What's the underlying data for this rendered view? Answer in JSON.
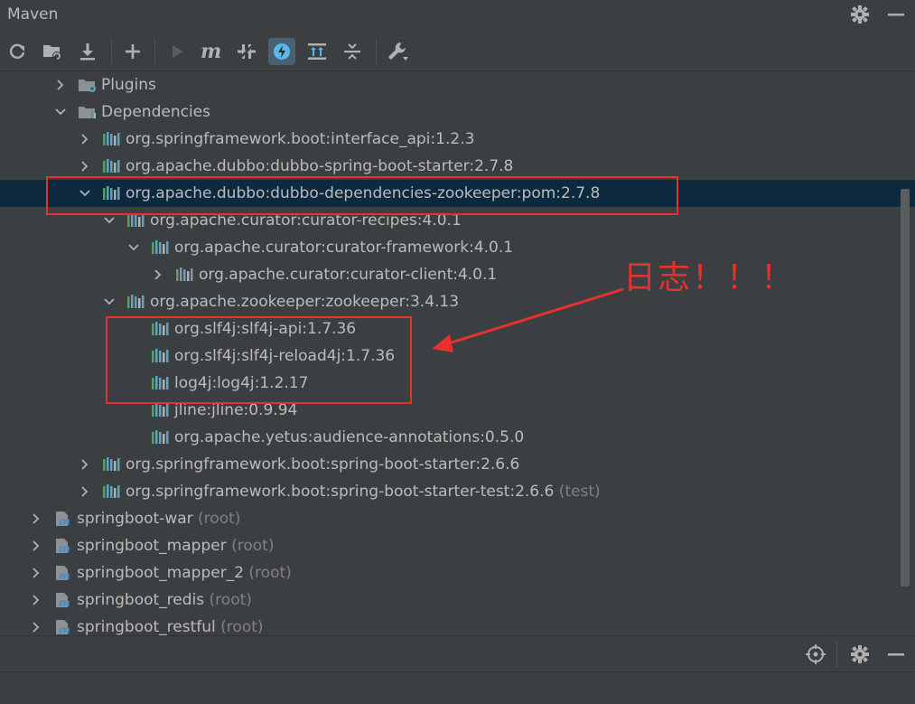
{
  "panel": {
    "title": "Maven"
  },
  "header_icons": [
    "settings-icon",
    "minimize-icon"
  ],
  "toolbar": {
    "buttons": [
      {
        "name": "reload-all-projects-icon"
      },
      {
        "name": "reimport-folder-icon"
      },
      {
        "name": "download-sources-icon"
      },
      {
        "name": "add-project-icon"
      },
      {
        "name": "run-icon"
      },
      {
        "name": "execute-maven-goal-icon"
      },
      {
        "name": "toggle-offline-icon"
      },
      {
        "name": "skip-tests-icon"
      },
      {
        "name": "show-dependencies-icon"
      },
      {
        "name": "collapse-all-icon"
      },
      {
        "name": "settings-wrench-icon"
      }
    ],
    "active_button": "skip-tests-icon"
  },
  "tree": {
    "rows": [
      {
        "label": "Plugins",
        "suffix": "",
        "kind": "folder-plugins",
        "expand": "collapsed"
      },
      {
        "label": "Dependencies",
        "suffix": "",
        "kind": "folder-deps",
        "expand": "expanded"
      },
      {
        "label": "org.springframework.boot:interface_api:1.2.3",
        "suffix": "",
        "kind": "library",
        "expand": "collapsed"
      },
      {
        "label": "org.apache.dubbo:dubbo-spring-boot-starter:2.7.8",
        "suffix": "",
        "kind": "library",
        "expand": "collapsed"
      },
      {
        "label": "org.apache.dubbo:dubbo-dependencies-zookeeper:pom:2.7.8",
        "suffix": "",
        "kind": "library",
        "expand": "expanded",
        "selected": true
      },
      {
        "label": "org.apache.curator:curator-recipes:4.0.1",
        "suffix": "",
        "kind": "library",
        "expand": "expanded"
      },
      {
        "label": "org.apache.curator:curator-framework:4.0.1",
        "suffix": "",
        "kind": "library",
        "expand": "expanded"
      },
      {
        "label": "org.apache.curator:curator-client:4.0.1",
        "suffix": "",
        "kind": "library",
        "expand": "collapsed"
      },
      {
        "label": "org.apache.zookeeper:zookeeper:3.4.13",
        "suffix": "",
        "kind": "library",
        "expand": "expanded"
      },
      {
        "label": "org.slf4j:slf4j-api:1.7.36",
        "suffix": "",
        "kind": "library",
        "expand": "none"
      },
      {
        "label": "org.slf4j:slf4j-reload4j:1.7.36",
        "suffix": "",
        "kind": "library",
        "expand": "none"
      },
      {
        "label": "log4j:log4j:1.2.17",
        "suffix": "",
        "kind": "library",
        "expand": "none"
      },
      {
        "label": "jline:jline:0.9.94",
        "suffix": "",
        "kind": "library",
        "expand": "none"
      },
      {
        "label": "org.apache.yetus:audience-annotations:0.5.0",
        "suffix": "",
        "kind": "library",
        "expand": "none"
      },
      {
        "label": "org.springframework.boot:spring-boot-starter:2.6.6",
        "suffix": "",
        "kind": "library",
        "expand": "collapsed"
      },
      {
        "label": "org.springframework.boot:spring-boot-starter-test:2.6.6",
        "suffix": "(test)",
        "kind": "library",
        "expand": "collapsed"
      },
      {
        "label": "springboot-war",
        "suffix": "(root)",
        "kind": "module",
        "expand": "collapsed"
      },
      {
        "label": "springboot_mapper",
        "suffix": "(root)",
        "kind": "module",
        "expand": "collapsed"
      },
      {
        "label": "springboot_mapper_2",
        "suffix": "(root)",
        "kind": "module",
        "expand": "collapsed"
      },
      {
        "label": "springboot_redis",
        "suffix": "(root)",
        "kind": "module",
        "expand": "collapsed"
      },
      {
        "label": "springboot_restful",
        "suffix": "(root)",
        "kind": "module",
        "expand": "collapsed"
      }
    ]
  },
  "bottom_icons": [
    "locate-icon",
    "settings-icon",
    "minimize-icon"
  ],
  "annotation": {
    "text": "日志！！！",
    "color": "#e5312f"
  },
  "colors": {
    "background": "#3c3f41",
    "selection": "#0d293e",
    "text": "#bbbbbb",
    "muted": "#808080",
    "library_icon": "#6a9fb5",
    "annotation": "#e5312f"
  }
}
